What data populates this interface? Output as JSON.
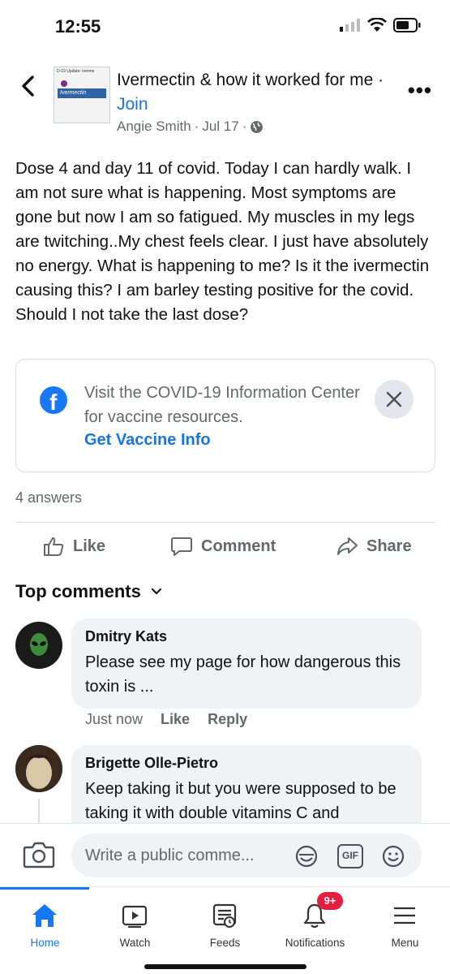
{
  "status_bar": {
    "time": "12:55"
  },
  "header": {
    "group_title": "Ivermectin & how it worked for me",
    "separator": " · ",
    "join_label": "Join",
    "author": "Angie Smith",
    "date": "Jul 17",
    "meta_dot": "·",
    "thumb_top_text": "D-19 Update: Iverme",
    "thumb_band_text": "Ivermectin"
  },
  "post": {
    "body": "Dose 4 and day 11 of covid. Today I can hardly walk. I am not sure what is happening. Most symptoms are gone but now I am so fatigued. My muscles in my legs are twitching..My chest feels clear. I just have absolutely no energy.  What is happening to me? Is it the ivermectin causing this? I am barley testing positive for the covid. Should I not take the last dose?"
  },
  "info_card": {
    "text": "Visit the COVID-19 Information Center for vaccine resources.",
    "link": "Get Vaccine Info"
  },
  "answers_count": "4 answers",
  "actions": {
    "like": "Like",
    "comment": "Comment",
    "share": "Share"
  },
  "comments_header": "Top comments",
  "comments": [
    {
      "name": "Dmitry Kats",
      "text": "Please see my page for how dangerous this toxin is ...",
      "time": "Just now",
      "like": "Like",
      "reply": "Reply"
    },
    {
      "name": "Brigette Olle-Pietro",
      "text": "Keep taking it but you were supposed to be taking it with double vitamins C and"
    }
  ],
  "compose": {
    "placeholder": "Write a public comme...",
    "gif_label": "GIF"
  },
  "tabs": [
    {
      "label": "Home"
    },
    {
      "label": "Watch"
    },
    {
      "label": "Feeds"
    },
    {
      "label": "Notifications",
      "badge": "9+"
    },
    {
      "label": "Menu"
    }
  ],
  "colors": {
    "accent": "#1877f2",
    "link": "#1b74e4",
    "badge": "#e41e3f",
    "secondary_text": "#65676b"
  },
  "icons": [
    "back-arrow-icon",
    "more-icon",
    "globe-icon",
    "facebook-icon",
    "close-icon",
    "like-icon",
    "comment-icon",
    "share-icon",
    "chevron-down-icon",
    "camera-icon",
    "sticker-icon",
    "gif-icon",
    "emoji-icon",
    "home-icon",
    "watch-icon",
    "feeds-icon",
    "bell-icon",
    "menu-icon"
  ]
}
